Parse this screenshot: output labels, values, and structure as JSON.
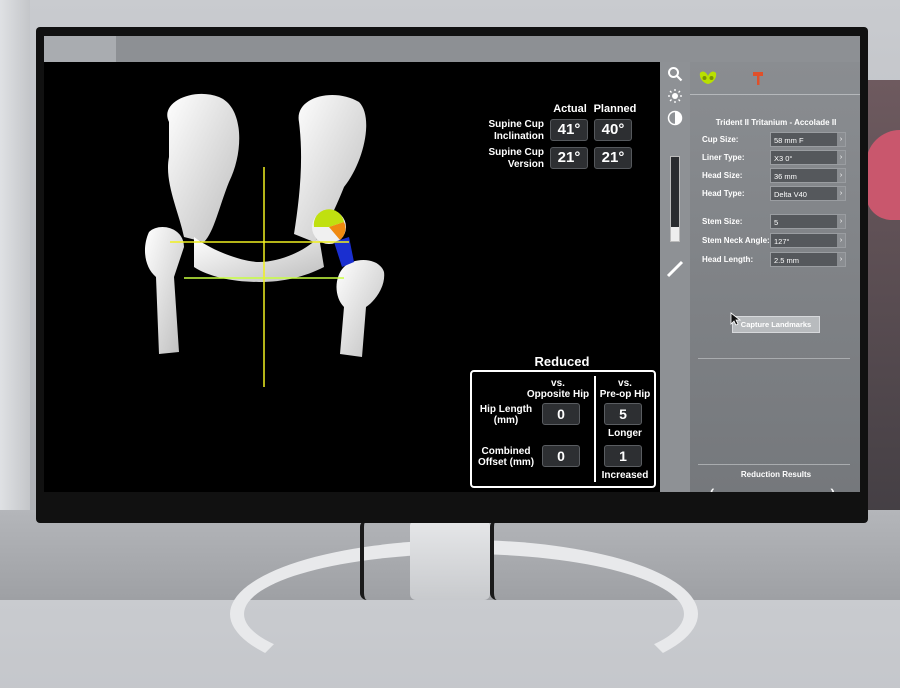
{
  "measurements": {
    "header_actual": "Actual",
    "header_planned": "Planned",
    "rows": [
      {
        "label_line1": "Supine Cup",
        "label_line2": "Inclination",
        "actual": "41°",
        "planned": "40°"
      },
      {
        "label_line1": "Supine Cup",
        "label_line2": "Version",
        "actual": "21°",
        "planned": "21°"
      }
    ]
  },
  "reduced": {
    "title": "Reduced",
    "col1_line1": "vs.",
    "col1_line2": "Opposite Hip",
    "col2_line1": "vs.",
    "col2_line2": "Pre-op Hip",
    "rows": [
      {
        "label_line1": "Hip Length",
        "label_line2": "(mm)",
        "vs_opposite": "0",
        "vs_preop": "5",
        "note": "Longer"
      },
      {
        "label_line1": "Combined",
        "label_line2": "Offset (mm)",
        "vs_opposite": "0",
        "vs_preop": "1",
        "note": "Increased"
      }
    ]
  },
  "panel": {
    "implant_title": "Trident II Tritanium - Accolade II",
    "fields": [
      {
        "label": "Cup Size:",
        "value": "58 mm F"
      },
      {
        "label": "Liner Type:",
        "value": "X3 0°"
      },
      {
        "label": "Head Size:",
        "value": "36 mm"
      },
      {
        "label": "Head Type:",
        "value": "Delta V40"
      },
      {
        "label": "Stem Size:",
        "value": "5"
      },
      {
        "label": "Stem Neck Angle:",
        "value": "127°"
      },
      {
        "label": "Head Length:",
        "value": "2.5 mm"
      }
    ],
    "capture_button": "Capture Landmarks",
    "reduction_results": "Reduction Results",
    "nav_prev": "‹",
    "nav_next": "›"
  },
  "colors": {
    "crosshair": "#f0f020",
    "pelvis_icon": "#b9e000",
    "hammer_icon": "#e0502a"
  },
  "icons": [
    "search-icon",
    "brightness-icon",
    "contrast-icon",
    "ruler-icon",
    "pelvis-icon",
    "hammer-icon",
    "chevron-left-icon",
    "chevron-right-icon",
    "mouse-cursor-icon"
  ]
}
